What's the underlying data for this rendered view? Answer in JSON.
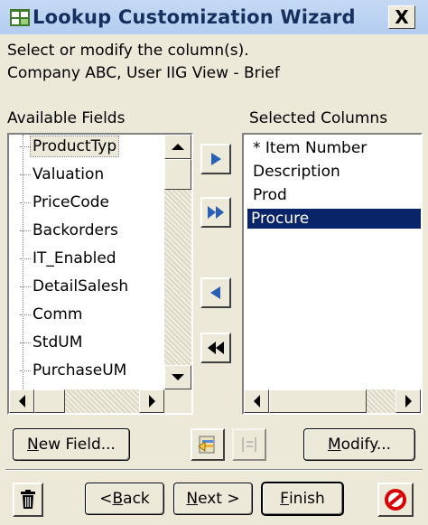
{
  "window": {
    "title": "Lookup Customization Wizard",
    "close_label": "X"
  },
  "instructions": {
    "line1": "Select or modify the column(s).",
    "line2": "Company ABC, User IIG View - Brief"
  },
  "available": {
    "label": "Available Fields",
    "items": [
      "ProductTyp",
      "Valuation",
      "PriceCode",
      "Backorders",
      "IT_Enabled",
      "DetailSalesh",
      "Comm",
      "StdUM",
      "PurchaseUM"
    ]
  },
  "selected": {
    "label": "Selected Columns",
    "items": [
      "* Item Number",
      "Description",
      "Prod",
      "Procure"
    ],
    "selected_index": 3
  },
  "buttons": {
    "new_field": {
      "before": "",
      "mnemonic": "N",
      "after": "ew Field..."
    },
    "modify": {
      "before": "",
      "mnemonic": "M",
      "after": "odify..."
    },
    "back": {
      "before": "< ",
      "mnemonic": "B",
      "after": "ack"
    },
    "next": {
      "before": "",
      "mnemonic": "N",
      "after": "ext >"
    },
    "finish": {
      "before": "",
      "mnemonic": "F",
      "after": "inish"
    }
  },
  "icons": {
    "move_right": "play-right-icon",
    "move_all_right": "fast-forward-icon",
    "move_left": "play-left-icon",
    "move_all_left": "rewind-icon",
    "properties": "column-properties-icon",
    "reorder": "list-disabled-icon",
    "delete": "trash-icon",
    "cancel": "no-entry-icon"
  },
  "colors": {
    "selection": "#0a246a",
    "arrow_blue": "#2a5fb8",
    "cancel_red": "#d80000"
  }
}
